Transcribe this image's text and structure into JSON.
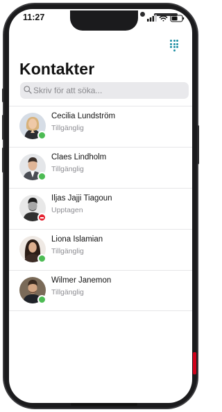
{
  "status_bar": {
    "time": "11:27"
  },
  "header": {
    "title": "Kontakter",
    "dialpad_icon": "dialpad-icon"
  },
  "search": {
    "placeholder": "Skriv för att söka..."
  },
  "colors": {
    "available": "#4cbb53",
    "busy": "#e5202e",
    "accent": "#1f8fa3"
  },
  "contacts": [
    {
      "name": "Cecilia Lundström",
      "status": "Tillgänglig",
      "presence": "available"
    },
    {
      "name": "Claes Lindholm",
      "status": "Tillgänglig",
      "presence": "available"
    },
    {
      "name": "Iljas Jajji Tiagoun",
      "status": "Upptagen",
      "presence": "busy"
    },
    {
      "name": "Liona Islamian",
      "status": "Tillgänglig",
      "presence": "available"
    },
    {
      "name": "Wilmer Janemon",
      "status": "Tillgänglig",
      "presence": "available"
    }
  ]
}
